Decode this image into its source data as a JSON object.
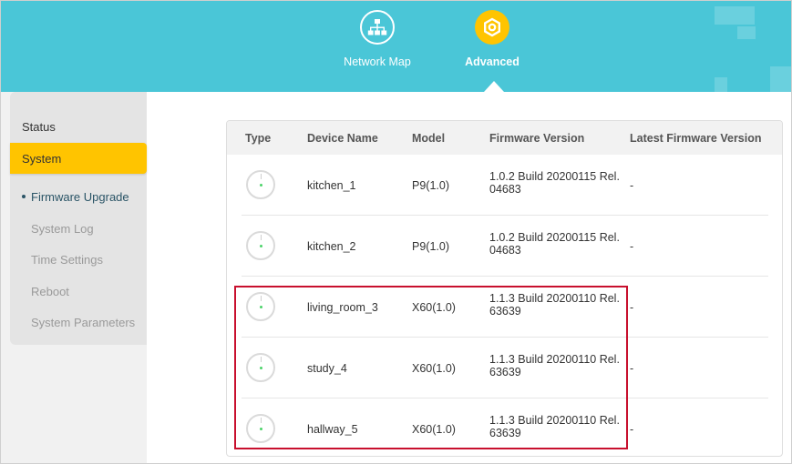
{
  "header": {
    "tabs": [
      {
        "label": "Network Map",
        "icon": "network-map-icon"
      },
      {
        "label": "Advanced",
        "icon": "advanced-gear-icon",
        "active": true
      }
    ],
    "background_color": "#4ac6d7",
    "accent_color": "#ffc400"
  },
  "sidebar": {
    "items": [
      {
        "label": "Status"
      },
      {
        "label": "System",
        "active": true
      }
    ],
    "sub_items": [
      {
        "label": "Firmware Upgrade",
        "active": true
      },
      {
        "label": "System Log"
      },
      {
        "label": "Time Settings"
      },
      {
        "label": "Reboot"
      },
      {
        "label": "System Parameters"
      }
    ]
  },
  "table": {
    "columns": [
      "Type",
      "Device Name",
      "Model",
      "Firmware Version",
      "Latest Firmware Version"
    ],
    "rows": [
      {
        "name": "kitchen_1",
        "model": "P9(1.0)",
        "firmware": "1.0.2 Build 20200115 Rel. 04683",
        "latest": "-"
      },
      {
        "name": "kitchen_2",
        "model": "P9(1.0)",
        "firmware": "1.0.2 Build 20200115 Rel. 04683",
        "latest": "-"
      },
      {
        "name": "living_room_3",
        "model": "X60(1.0)",
        "firmware": "1.1.3 Build 20200110 Rel. 63639",
        "latest": "-"
      },
      {
        "name": "study_4",
        "model": "X60(1.0)",
        "firmware": "1.1.3 Build 20200110 Rel. 63639",
        "latest": "-"
      },
      {
        "name": "hallway_5",
        "model": "X60(1.0)",
        "firmware": "1.1.3 Build 20200110 Rel. 63639",
        "latest": "-"
      }
    ],
    "highlight_color": "#c8102e"
  }
}
